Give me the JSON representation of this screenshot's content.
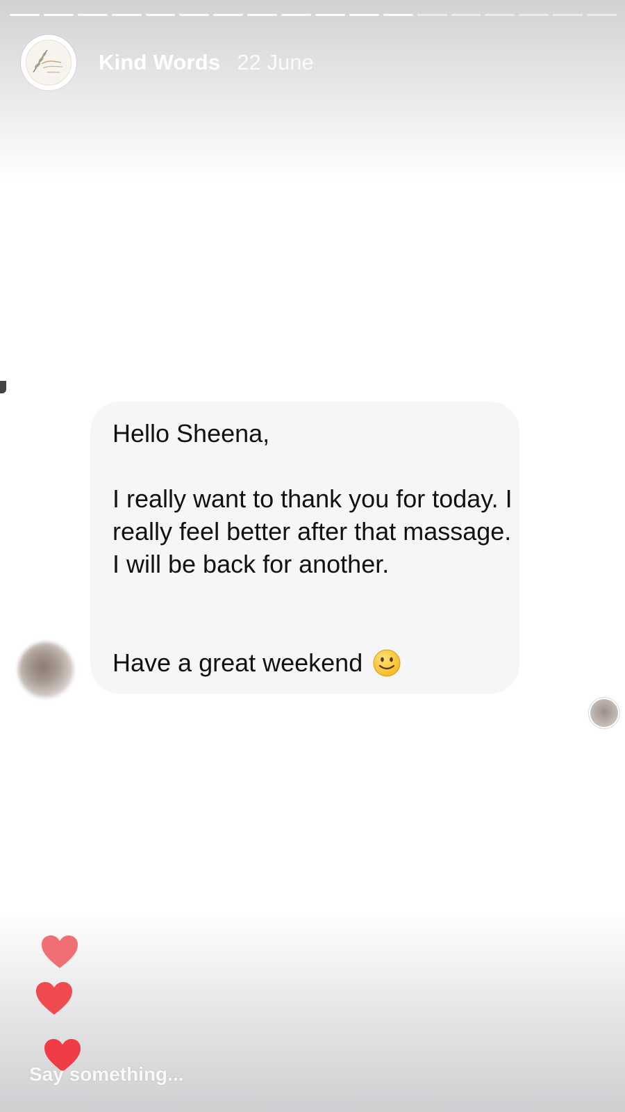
{
  "story": {
    "title": "Kind Words",
    "date": "22 June",
    "segments_total": 18,
    "segments_done": 12
  },
  "message": {
    "greeting": "Hello Sheena,",
    "body": "I really want to thank you for today. I really feel better after that massage. I will be back for another.",
    "closing": "Have a great weekend"
  },
  "reactions": {
    "hearts": [
      "heart-icon",
      "heart-icon",
      "heart-icon"
    ],
    "heart_colors": [
      "#ef6f74",
      "#ef4a4f",
      "#ef3c45"
    ]
  },
  "reply": {
    "placeholder": "Say something..."
  }
}
